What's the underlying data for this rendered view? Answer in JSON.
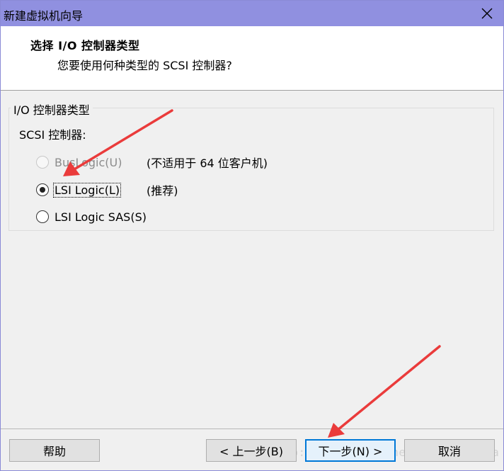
{
  "window": {
    "title": "新建虚拟机向导"
  },
  "header": {
    "title": "选择 I/O 控制器类型",
    "subtitle": "您要使用何种类型的 SCSI 控制器?"
  },
  "group": {
    "legend": "I/O 控制器类型",
    "scsi_label": "SCSI 控制器:"
  },
  "options": [
    {
      "label": "BusLogic(U)",
      "note": "(不适用于 64 位客户机)",
      "checked": false,
      "disabled": true
    },
    {
      "label": "LSI Logic(L)",
      "note": "(推荐)",
      "checked": true,
      "disabled": false
    },
    {
      "label": "LSI Logic SAS(S)",
      "note": "",
      "checked": false,
      "disabled": false
    }
  ],
  "buttons": {
    "help": "帮助",
    "back": "< 上一步(B)",
    "next": "下一步(N) >",
    "cancel": "取消"
  },
  "watermark": "http://blog.csdn.net/Magic_Ninja",
  "colors": {
    "titlebar": "#9090e0",
    "annotation_arrow": "#ea3b3b",
    "default_button_border": "#0078d7"
  },
  "icons": {
    "close": "close-icon"
  }
}
